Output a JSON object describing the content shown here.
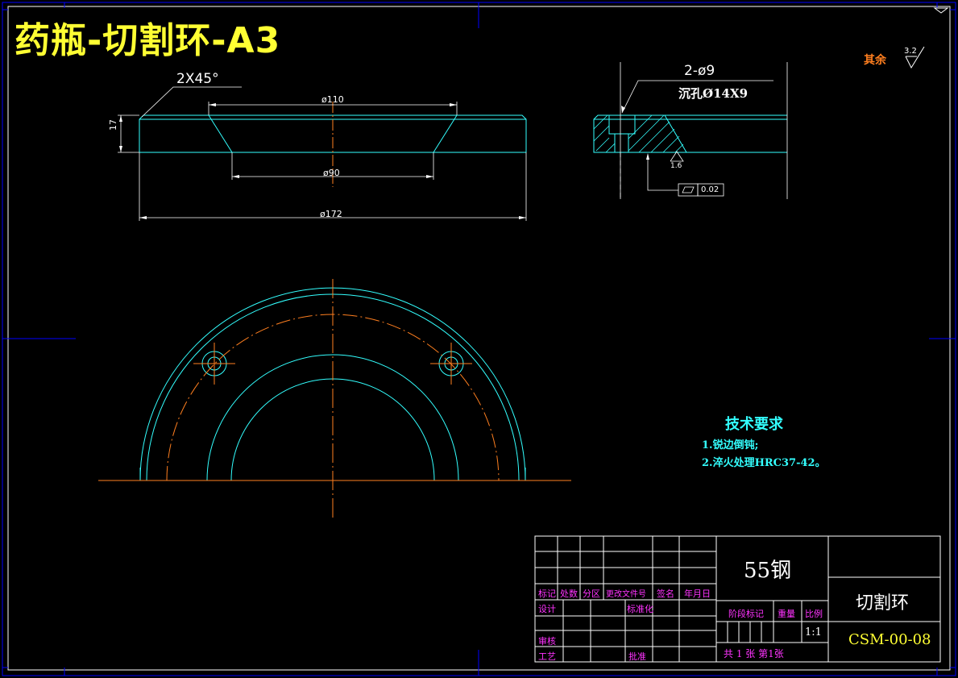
{
  "drawing_title": "药瓶-切割环-A3",
  "surface_roughness": {
    "label": "其余",
    "value": "3.2"
  },
  "section_view": {
    "chamfer": "2X45°",
    "thickness": "17",
    "diameter_top": "ø110",
    "diameter_inner": "ø90",
    "diameter_outer": "ø172"
  },
  "detail_view": {
    "hole_count": "2-ø9",
    "counterbore": "沉孔Ø14X9",
    "roughness": "1.6",
    "flatness": "0.02"
  },
  "technical_requirements": {
    "title": "技术要求",
    "items": [
      "1.锐边倒钝;",
      "2.淬火处理HRC37-42。"
    ]
  },
  "title_block": {
    "material": "55钢",
    "part_name": "切割环",
    "drawing_number": "CSM-00-08",
    "scale": "1:1",
    "headers": [
      "标记",
      "处数",
      "分区",
      "更改文件号",
      "签名",
      "年月日"
    ],
    "row_design": "设计",
    "row_standard": "标准化",
    "row_review": "审核",
    "row_process": "工艺",
    "row_approve": "批准",
    "stage_mark": "阶段标记",
    "weight": "重量",
    "scale_label": "比例",
    "sheets": "共 1 张 第1张"
  },
  "colors": {
    "border": "#0000ff",
    "frame": "#ffffff",
    "part_outline": "#33ffff",
    "center_line": "#ff7f1f",
    "dimension": "#ffffff",
    "title": "#ffff33"
  }
}
